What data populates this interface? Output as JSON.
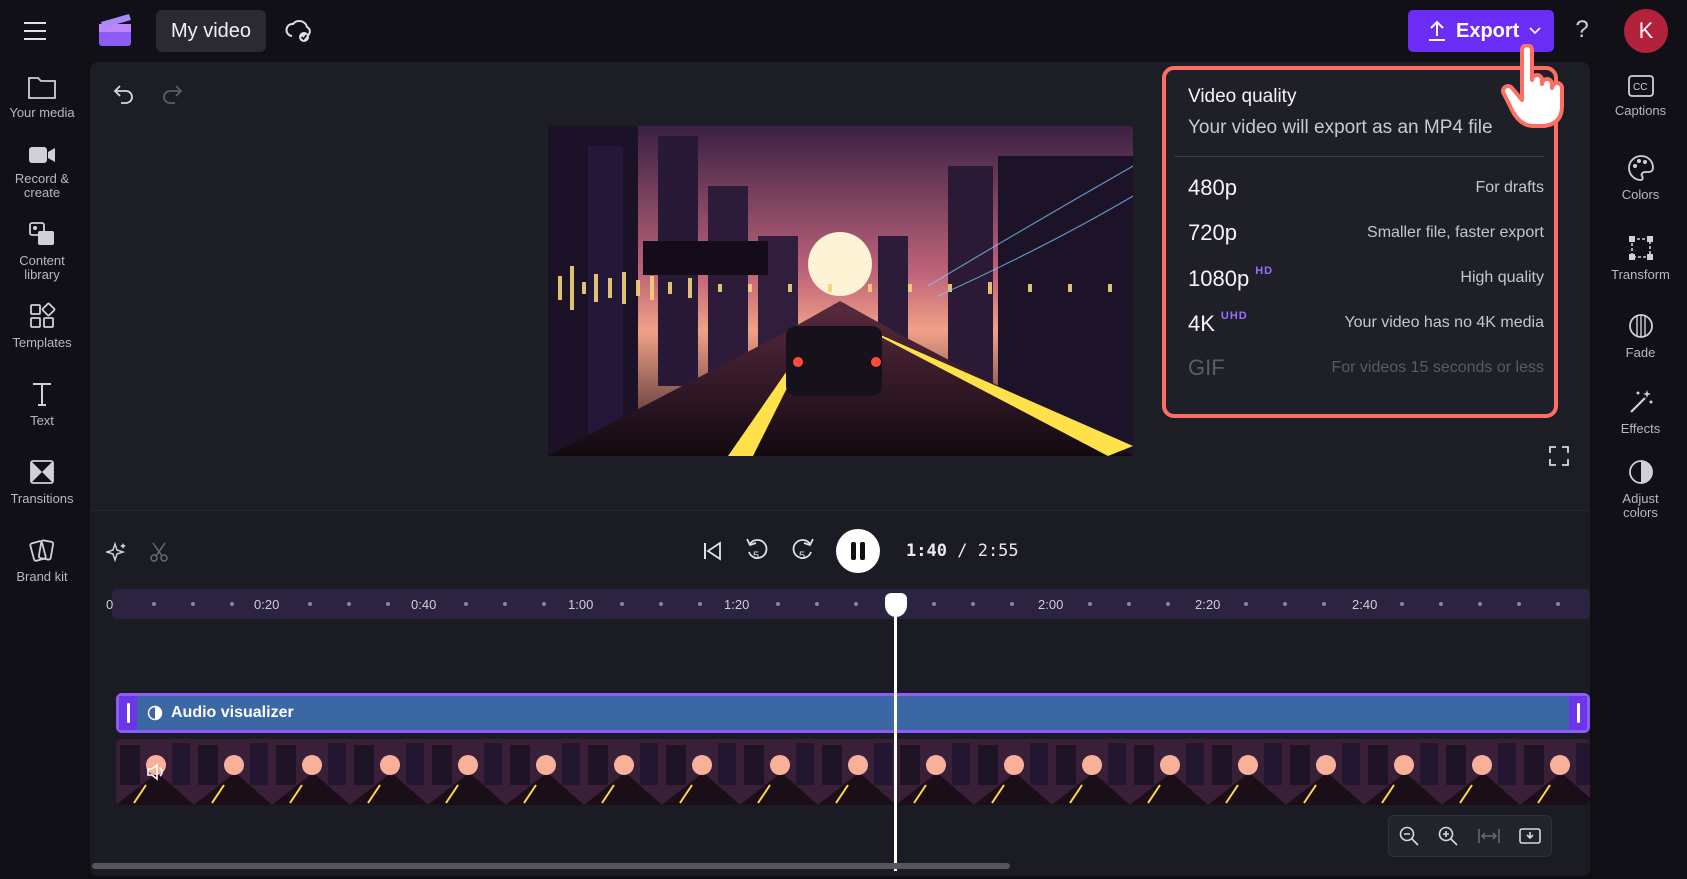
{
  "header": {
    "project_title": "My video",
    "export_label": "Export",
    "help_label": "?",
    "avatar_initial": "K"
  },
  "left_rail": [
    {
      "label": "Your media",
      "icon": "folder-icon"
    },
    {
      "label": "Record & create",
      "icon": "camera-icon"
    },
    {
      "label": "Content library",
      "icon": "content-library-icon"
    },
    {
      "label": "Templates",
      "icon": "templates-icon"
    },
    {
      "label": "Text",
      "icon": "text-icon"
    },
    {
      "label": "Transitions",
      "icon": "transitions-icon"
    },
    {
      "label": "Brand kit",
      "icon": "brand-kit-icon"
    }
  ],
  "right_rail": [
    {
      "label": "Captions",
      "icon": "captions-icon"
    },
    {
      "label": "Colors",
      "icon": "palette-icon"
    },
    {
      "label": "Transform",
      "icon": "transform-icon"
    },
    {
      "label": "Fade",
      "icon": "fade-icon"
    },
    {
      "label": "Effects",
      "icon": "magic-wand-icon"
    },
    {
      "label": "Adjust colors",
      "icon": "adjust-colors-icon"
    }
  ],
  "quality_panel": {
    "title": "Video quality",
    "subtitle": "Your video will export as an MP4 file",
    "options": [
      {
        "res": "480p",
        "badge": "",
        "desc": "For drafts",
        "enabled": true
      },
      {
        "res": "720p",
        "badge": "",
        "desc": "Smaller file, faster export",
        "enabled": true
      },
      {
        "res": "1080p",
        "badge": "HD",
        "desc": "High quality",
        "enabled": true
      },
      {
        "res": "4K",
        "badge": "UHD",
        "desc": "Your video has no 4K media",
        "enabled": true
      },
      {
        "res": "GIF",
        "badge": "",
        "desc": "For videos 15 seconds or less",
        "enabled": false
      }
    ]
  },
  "playback": {
    "current_time": "1:40",
    "separator": "/",
    "total_time": "2:55",
    "skip_back_seconds": "5",
    "skip_forward_seconds": "5"
  },
  "ruler_labels": [
    "0",
    "0:20",
    "0:40",
    "1:00",
    "1:20",
    "2:00",
    "2:20",
    "2:40"
  ],
  "tracks": {
    "audio_label": "Audio visualizer"
  },
  "colors": {
    "accent": "#6b2cf5",
    "highlight": "#ff6e62",
    "audio_track": "#3b67a4"
  }
}
